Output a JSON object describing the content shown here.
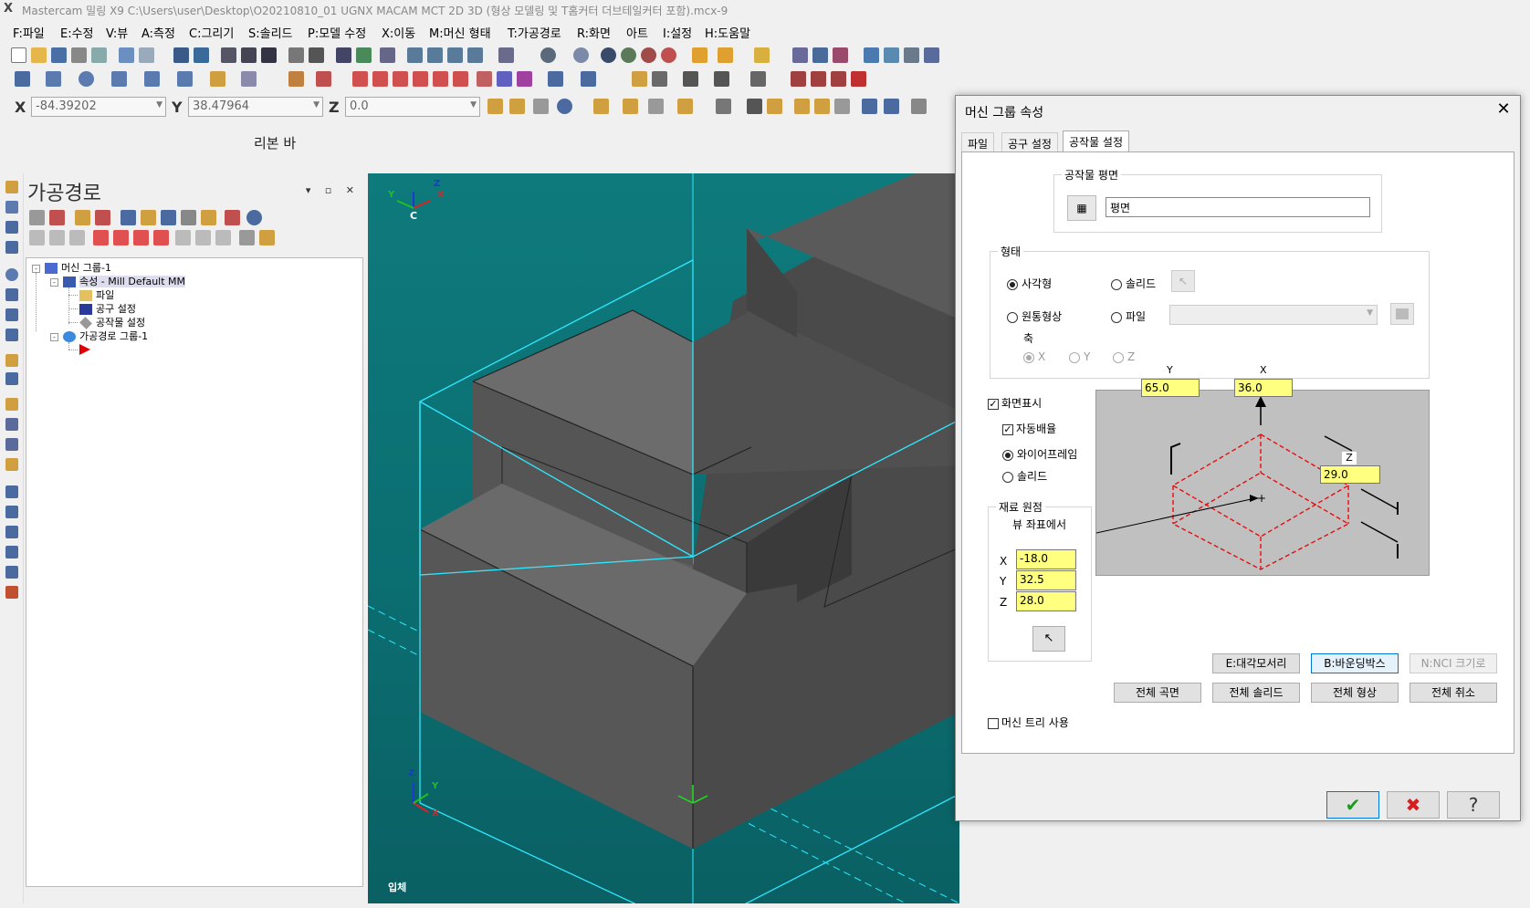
{
  "titlebar": {
    "logo": "X",
    "title": "Mastercam 밀링 X9  C:\\Users\\user\\Desktop\\O20210810_01 UGNX MACAM MCT 2D 3D (형상 모델링 및 T홈커터 더브테일커터 포함).mcx-9"
  },
  "menu": [
    "F:파일",
    "E:수정",
    "V:뷰",
    "A:측정",
    "C:그리기",
    "S:솔리드",
    "P:모델 수정",
    "X:이동",
    "M:머신 형태",
    "T:가공경로",
    "R:화면",
    "아트",
    "I:설정",
    "H:도움말"
  ],
  "coords": {
    "x_label": "X",
    "x_value": "-84.39202",
    "y_label": "Y",
    "y_value": "38.47964",
    "z_label": "Z",
    "z_value": "0.0"
  },
  "ribbon_label": "리본 바",
  "panel": {
    "title": "가공경로",
    "controls": "▾ ▫ ✕",
    "tree": {
      "machine_group": "머신 그룹-1",
      "properties": "속성 - Mill Default MM",
      "files": "파일",
      "tool_settings": "공구 설정",
      "stock_setup": "공작물 설정",
      "toolpath_group": "가공경로 그룹-1"
    }
  },
  "viewport": {
    "label": "입체",
    "triad_top": {
      "x": "X",
      "y": "Y",
      "z": "Z",
      "c": "C"
    },
    "triad_bottom": {
      "x": "X",
      "y": "Y",
      "z": "Z"
    }
  },
  "dialog": {
    "title": "머신 그룹 속성",
    "tabs": [
      "파일",
      "공구 설정",
      "공작물 설정"
    ],
    "active_tab": 2,
    "stock_plane": {
      "group_title": "공작물 평면",
      "value": "평면"
    },
    "shape": {
      "group_title": "형태",
      "rectangular": "사각형",
      "solid": "솔리드",
      "cylindrical": "원통형상",
      "file": "파일",
      "axis_label": "축",
      "axis_x": "X",
      "axis_y": "Y",
      "axis_z": "Z"
    },
    "display": {
      "show_on_screen": "화면표시",
      "auto_fit": "자동배율",
      "wireframe": "와이어프레임",
      "solid": "솔리드"
    },
    "preview": {
      "y_label": "Y",
      "y_value": "65.0",
      "x_label": "X",
      "x_value": "36.0",
      "z_label": "Z",
      "z_value": "29.0"
    },
    "stock_origin": {
      "group_title": "재료 원점",
      "subtitle": "뷰 좌표에서",
      "x_label": "X",
      "x_value": "-18.0",
      "y_label": "Y",
      "y_value": "32.5",
      "z_label": "Z",
      "z_value": "28.0"
    },
    "buttons": {
      "diagonal": "E:대각모서리",
      "bounding_box": "B:바운딩박스",
      "nci_extents": "N:NCI 크기로",
      "all_surfaces": "전체 곡면",
      "all_solids": "전체 솔리드",
      "all_entities": "전체 형상",
      "unselect_all": "전체 취소"
    },
    "use_machine_tree": "머신 트리 사용",
    "footer": {
      "ok": "✔",
      "cancel": "✖",
      "help": "?"
    }
  },
  "colors": {
    "viewport_bg": "#0b6e71",
    "highlight_input": "#ffff80",
    "stock_wire": "#00e5ff",
    "ok_green": "#1c9a1c",
    "cancel_red": "#d62020"
  }
}
